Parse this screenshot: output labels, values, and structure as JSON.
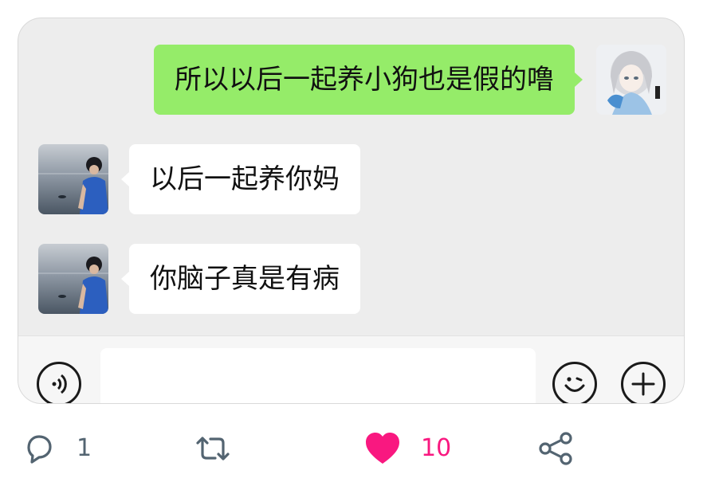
{
  "chat": {
    "messages": [
      {
        "sender": "self",
        "text": "所以以后一起养小狗也是假的噜"
      },
      {
        "sender": "other",
        "text": "以后一起养你妈"
      },
      {
        "sender": "other",
        "text": "你脑子真是有病"
      }
    ],
    "colors": {
      "background": "#ededed",
      "self_bubble": "#95ec69",
      "other_bubble": "#ffffff"
    }
  },
  "input_bar": {
    "voice_icon": "voice-icon",
    "emoji_icon": "emoji-icon",
    "plus_icon": "plus-icon"
  },
  "tweet_actions": {
    "reply_count": "1",
    "retweet_count": "",
    "like_count": "10",
    "liked": true,
    "like_color": "#f91880",
    "icons": [
      "reply-icon",
      "retweet-icon",
      "heart-icon",
      "share-icon"
    ]
  }
}
